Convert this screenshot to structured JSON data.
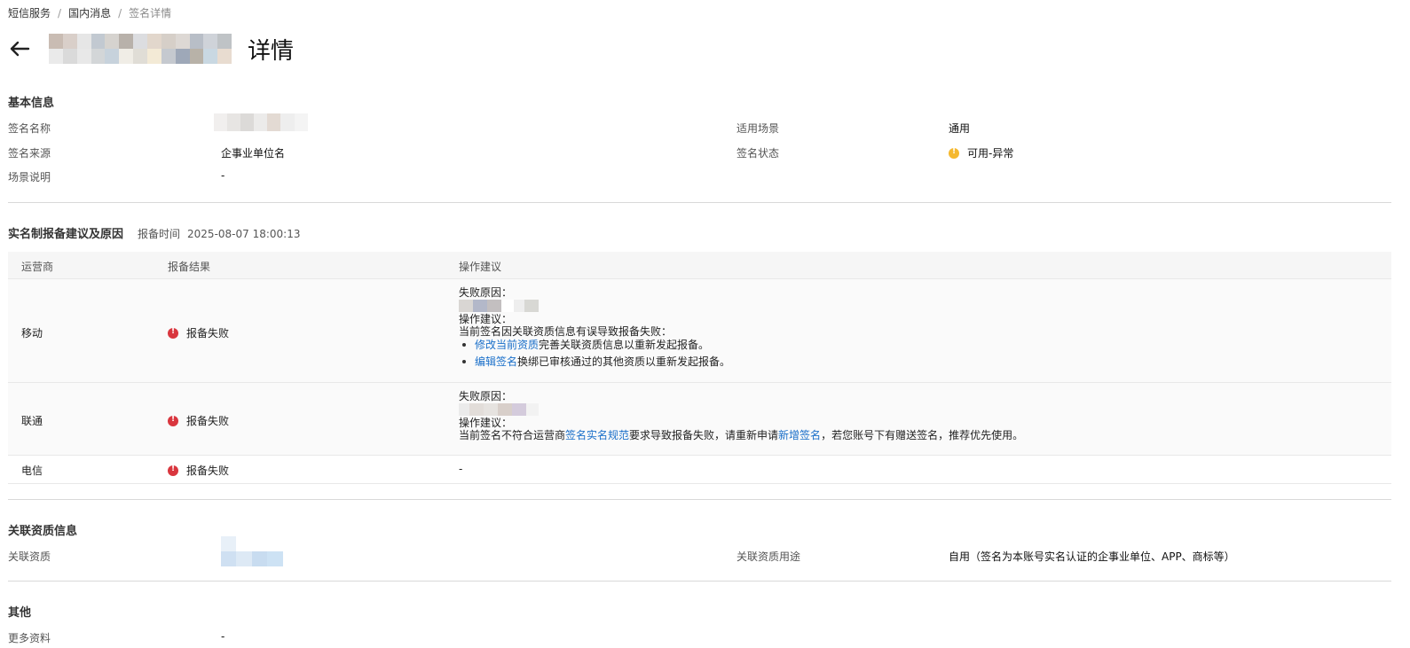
{
  "breadcrumb": {
    "items": [
      "短信服务",
      "国内消息"
    ],
    "current": "签名详情",
    "separator": "/"
  },
  "header": {
    "title_suffix": "详情"
  },
  "basic": {
    "section_title": "基本信息",
    "sign_name_label": "签名名称",
    "scene_label": "适用场景",
    "scene_value": "通用",
    "source_label": "签名来源",
    "source_value": "企事业单位名",
    "status_label": "签名状态",
    "status_value": "可用-异常",
    "desc_label": "场景说明",
    "desc_value": "-"
  },
  "report": {
    "section_title": "实名制报备建议及原因",
    "time_label": "报备时间",
    "time_value": "2025-08-07 18:00:13",
    "columns": [
      "运营商",
      "报备结果",
      "操作建议"
    ],
    "rows": [
      {
        "operator": "移动",
        "result": "报备失败",
        "reason_label": "失败原因：",
        "advice_label": "操作建议：",
        "advice_text": "当前签名因关联资质信息有误导致报备失败：",
        "bullets": [
          {
            "link": "修改当前资质",
            "text": "完善关联资质信息以重新发起报备。"
          },
          {
            "link": "编辑签名",
            "text": "换绑已审核通过的其他资质以重新发起报备。"
          }
        ]
      },
      {
        "operator": "联通",
        "result": "报备失败",
        "reason_label": "失败原因：",
        "advice_label": "操作建议：",
        "advice_pre": "当前签名不符合运营商",
        "advice_link1": "签名实名规范",
        "advice_mid": "要求导致报备失败，请重新申请",
        "advice_link2": "新增签名",
        "advice_post": "，若您账号下有赠送签名，推荐优先使用。"
      },
      {
        "operator": "电信",
        "result": "报备失败",
        "advice": "-"
      }
    ]
  },
  "qualification": {
    "section_title": "关联资质信息",
    "label": "关联资质",
    "usage_label": "关联资质用途",
    "usage_value": "自用（签名为本账号实名认证的企事业单位、APP、商标等）"
  },
  "other": {
    "section_title": "其他",
    "more_label": "更多资料",
    "more_value": "-"
  },
  "colors": {
    "link": "#1a6fc9",
    "warning": "#f5b82e",
    "error": "#d9363e",
    "divider": "#d9d9d9"
  },
  "icons": {
    "back": "arrow-left-icon",
    "status_warning": "warning-circle-icon",
    "status_error": "error-circle-icon"
  }
}
